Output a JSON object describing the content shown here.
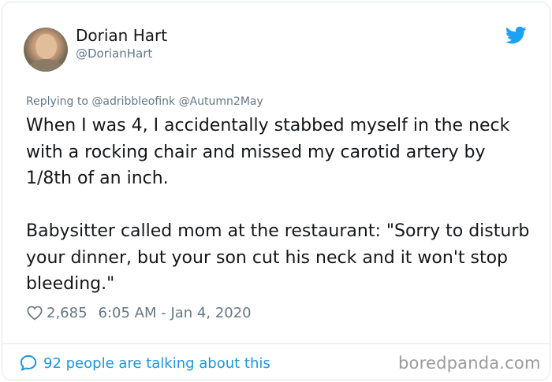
{
  "author": {
    "name": "Dorian Hart",
    "handle": "@DorianHart"
  },
  "reply": {
    "prefix": "Replying to",
    "mentions": "@adribbleofink @Autumn2May"
  },
  "tweet": {
    "text": "When I was 4, I accidentally stabbed myself in the neck with a rocking chair and missed my carotid artery by 1/8th of an inch.\n\nBabysitter called mom at the restaurant: \"Sorry to disturb your dinner, but your son cut his neck and it won't stop bleeding.\""
  },
  "meta": {
    "likes": "2,685",
    "timestamp": "6:05 AM - Jan 4, 2020"
  },
  "footer": {
    "talking": "92 people are talking about this",
    "watermark": "boredpanda.com"
  },
  "colors": {
    "twitter_blue": "#1da1f2",
    "link_blue": "#1b95e0",
    "secondary_text": "#657786",
    "primary_text": "#14171a"
  },
  "icons": {
    "brand": "twitter-bird-icon",
    "like": "heart-icon",
    "conversation": "speech-bubble-icon"
  }
}
